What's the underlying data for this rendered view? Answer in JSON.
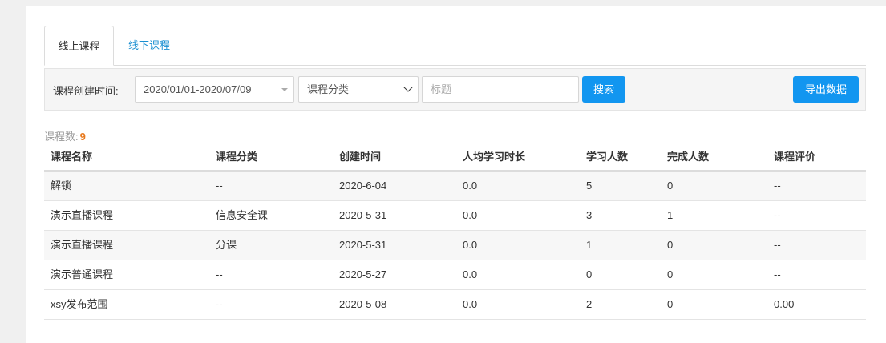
{
  "tabs": [
    {
      "label": "线上课程",
      "active": true
    },
    {
      "label": "线下课程",
      "active": false
    }
  ],
  "filters": {
    "created_label": "课程创建时间:",
    "date_range": "2020/01/01-2020/07/09",
    "category_selected": "课程分类",
    "title_placeholder": "标题",
    "search_label": "搜索",
    "export_label": "导出数据"
  },
  "summary": {
    "count_label": "课程数:",
    "count_value": "9"
  },
  "table": {
    "headers": [
      "课程名称",
      "课程分类",
      "创建时间",
      "人均学习时长",
      "学习人数",
      "完成人数",
      "课程评价"
    ],
    "rows": [
      [
        "解锁",
        "--",
        "2020-6-04",
        "0.0",
        "5",
        "0",
        "--"
      ],
      [
        "演示直播课程",
        "信息安全课",
        "2020-5-31",
        "0.0",
        "3",
        "1",
        "--"
      ],
      [
        "演示直播课程",
        "分课",
        "2020-5-31",
        "0.0",
        "1",
        "0",
        "--"
      ],
      [
        "演示普通课程",
        "--",
        "2020-5-27",
        "0.0",
        "0",
        "0",
        "--"
      ],
      [
        "xsy发布范围",
        "--",
        "2020-5-08",
        "0.0",
        "2",
        "0",
        "0.00"
      ]
    ]
  },
  "colors": {
    "accent": "#1296f0",
    "count": "#e8791d",
    "tab_link": "#1a8fd1"
  }
}
